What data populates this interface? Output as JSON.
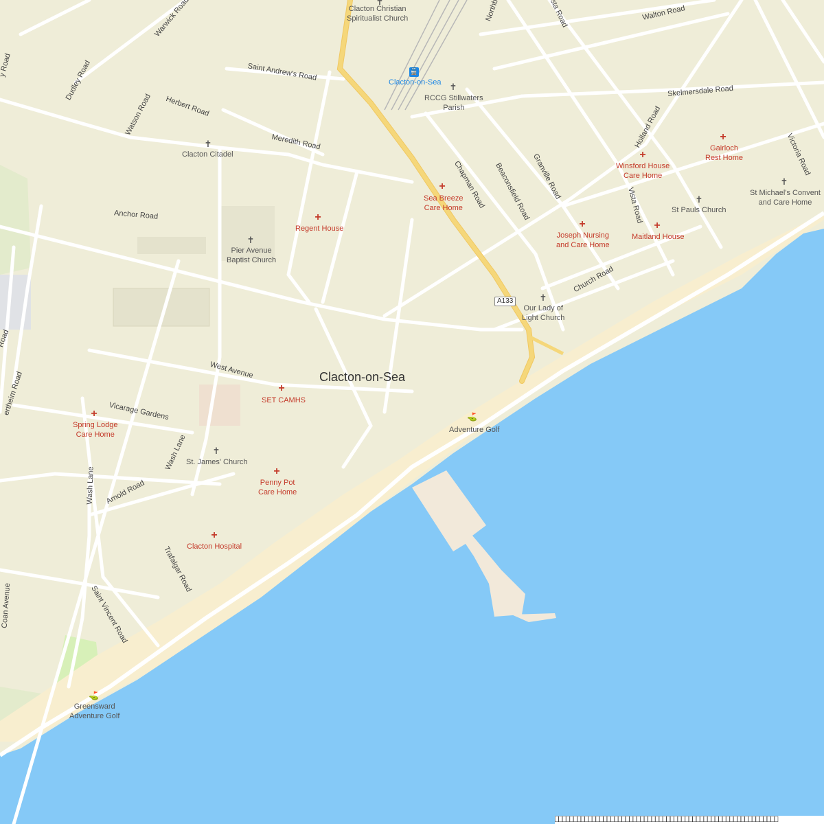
{
  "map": {
    "city_label": "Clacton-on-Sea",
    "road_shield": "A133",
    "colors": {
      "land": "#efedd8",
      "sea": "#85c9f7",
      "major_road": "#f5d77a",
      "minor_road": "#ffffff",
      "beach": "#f8eecf",
      "park": "#d7f0b8",
      "health": "#c43a2a",
      "station": "#1e88e5"
    },
    "places": {
      "spiritualist_church": "Clacton Christian\nSpiritualist Church",
      "station": "Clacton-on-Sea",
      "rccg": "RCCG Stillwaters\nParish",
      "citadel": "Clacton Citadel",
      "regent_house": "Regent House",
      "sea_breeze": "Sea Breeze\nCare Home",
      "winsford": "Winsford House\nCare Home",
      "gairloch": "Gairloch\nRest Home",
      "st_michaels": "St Michael's Convent\nand Care Home",
      "st_pauls": "St Pauls Church",
      "joseph": "Joseph Nursing\nand Care Home",
      "maitland": "Maitland House",
      "pier_avenue": "Pier Avenue\nBaptist Church",
      "our_lady": "Our Lady of\nLight Church",
      "set_camhs": "SET CAMHS",
      "spring_lodge": "Spring Lodge\nCare Home",
      "st_james": "St. James' Church",
      "penny_pot": "Penny Pot\nCare Home",
      "clacton_hospital": "Clacton Hospital",
      "adventure_golf": "Adventure Golf",
      "greensward": "Greensward\nAdventure Golf"
    },
    "streets": {
      "walton_road": "Walton Road",
      "vista_road_top": "Vista Road",
      "northbourne": "Northb",
      "warwick_road": "Warwick Road",
      "saint_andrews": "Saint Andrew's Road",
      "dudley_road": "Dudley Road",
      "herbert_road": "Herbert Road",
      "watson_road": "Watson Road",
      "skelmersdale": "Skelmersdale Road",
      "holland_road": "Holland Road",
      "meredith_road": "Meredith Road",
      "chapman_road": "Chapman Road",
      "beaconsfield": "Beaconsfield Road",
      "granville": "Granville Road",
      "victoria_road": "Victoria Road",
      "vista_road": "Vista Road",
      "anchor_road": "Anchor Road",
      "church_road": "Church Road",
      "west_avenue": "West Avenue",
      "vicarage_gardens": "Vicarage Gardens",
      "wash_lane": "Wash Lane",
      "wash_lane_south": "Wash Lane",
      "arnold_road": "Arnold Road",
      "trafalgar_road": "Trafalgar Road",
      "saint_vincent": "Saint Vincent Road",
      "coan_avenue": "Coan Avenue",
      "oxford_road": "y Road",
      "road_left": "Road",
      "bertheim": "ertheim Road"
    },
    "icons": {
      "health": "health-cross-icon",
      "church": "church-cross-icon",
      "train": "train-station-icon",
      "golf": "golf-icon"
    }
  },
  "attribution": "⎕⎕⎕⎕⎕⎕⎕⎕⎕⎕⎕⎕⎕⎕⎕⎕⎕⎕⎕⎕⎕⎕⎕⎕⎕⎕⎕⎕⎕⎕⎕⎕⎕⎕⎕⎕⎕⎕⎕⎕⎕⎕⎕⎕⎕⎕⎕⎕⎕⎕⎕⎕⎕⎕⎕⎕⎕⎕⎕⎕"
}
